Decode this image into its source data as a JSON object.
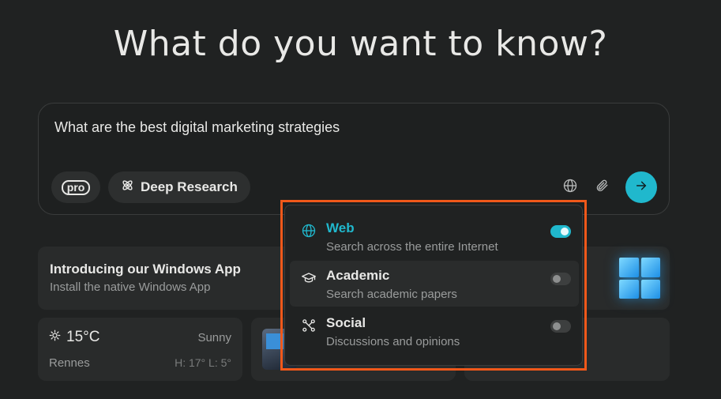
{
  "heading": "What do you want to know?",
  "search": {
    "query": "What are the best digital marketing strategies",
    "pro_label": "pro",
    "deep_research_label": "Deep Research"
  },
  "sources_menu": {
    "options": [
      {
        "title": "Web",
        "description": "Search across the entire Internet",
        "icon": "globe-icon",
        "enabled": true
      },
      {
        "title": "Academic",
        "description": "Search academic papers",
        "icon": "graduation-cap-icon",
        "enabled": false
      },
      {
        "title": "Social",
        "description": "Discussions and opinions",
        "icon": "network-icon",
        "enabled": false
      }
    ]
  },
  "app_promo": {
    "title": "Introducing our Windows App",
    "subtitle": "Install the native Windows App"
  },
  "weather": {
    "temperature": "15°C",
    "condition": "Sunny",
    "city": "Rennes",
    "high_low": "H: 17° L: 5°"
  },
  "colors": {
    "accent": "#20b8cd",
    "highlight_frame": "#f0581a",
    "background": "#202222"
  }
}
